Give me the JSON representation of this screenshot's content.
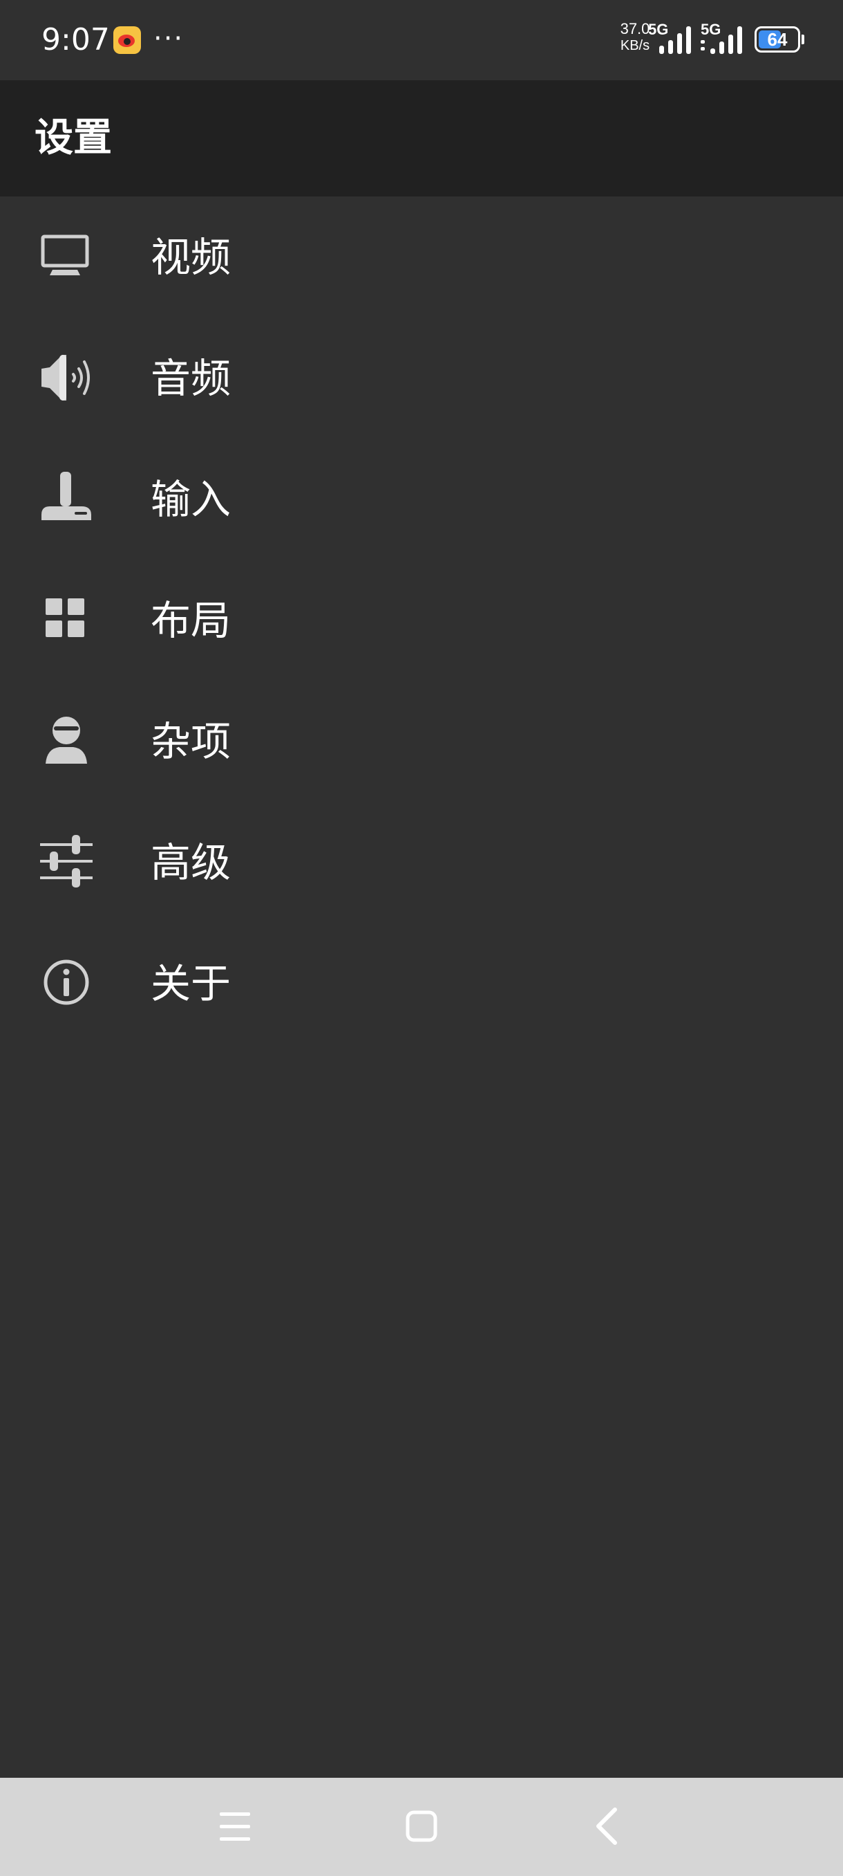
{
  "status_bar": {
    "time": "9:07",
    "more": "···",
    "net_speed_value": "37.0",
    "net_speed_unit": "KB/s",
    "sim1_label": "5G",
    "sim2_label": "5G",
    "battery_percent": "64",
    "battery_level": 0.64
  },
  "toolbar": {
    "title": "设置"
  },
  "settings": {
    "items": [
      {
        "label": "视频",
        "icon": "monitor-icon"
      },
      {
        "label": "音频",
        "icon": "speaker-icon"
      },
      {
        "label": "输入",
        "icon": "joystick-icon"
      },
      {
        "label": "布局",
        "icon": "grid-icon"
      },
      {
        "label": "杂项",
        "icon": "user-icon"
      },
      {
        "label": "高级",
        "icon": "sliders-icon"
      },
      {
        "label": "关于",
        "icon": "info-icon"
      }
    ]
  },
  "colors": {
    "background": "#303030",
    "toolbar": "#212121",
    "icon": "#d0d0d0",
    "nav_bar": "#d6d6d6",
    "battery_fill": "#3d8ef0"
  }
}
